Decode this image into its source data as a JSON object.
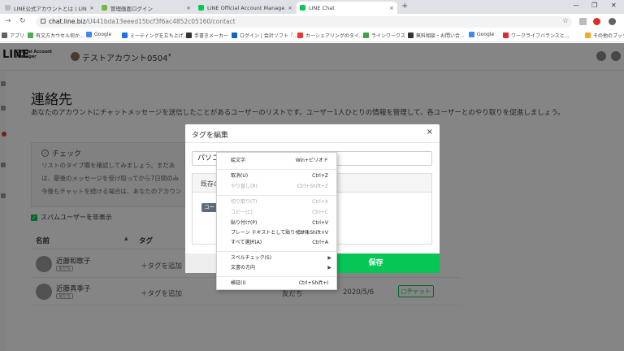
{
  "browser": {
    "tabs": [
      {
        "title": "LINE公式アカウントとは | LINE for Bu",
        "favicon": "grey"
      },
      {
        "title": "管理画面ログイン",
        "favicon": "img"
      },
      {
        "title": "LINE Official Account Manager",
        "favicon": "line"
      },
      {
        "title": "LINE Chat",
        "favicon": "line"
      }
    ],
    "new_tab": "+",
    "url_host": "chat.line.biz",
    "url_path": "/U441bda13eeed15bcf3f6ac4852c05160/contact",
    "bookmarks": [
      "アプリ",
      "有文方カウセル何か...",
      "Google",
      "ミーティングを立ち上げ...",
      "手書きメーカー",
      "ログイン | 会計ソフト「...",
      "カーシェアリングのタイ...",
      "ラインワークス",
      "無料相談・お問い合...",
      "Google",
      "ワークライフバランスと...",
      "その他のブックマーク"
    ]
  },
  "app": {
    "logo": "LINE",
    "logo_sub_1": "Official Account",
    "logo_sub_2": "Manager",
    "account_name": "テストアカウント0504",
    "caret": "▾"
  },
  "page": {
    "title": "連絡先",
    "description": "あなたのアカウントにチャットメッセージを送信したことがあるユーザーのリストです。ユーザー1人ひとりの情報を管理して、各ユーザーとのやり取りを促進しましょう。",
    "check_box": {
      "title": "チェック",
      "lines": [
        "リストのタイプ欄を確認してみましょう。まだあ",
        "は、最後のメッセージを受け取ってから7日間のみ",
        "今後もチャットを続ける場合は、あなたのアカウン"
      ]
    },
    "spam_label": "スパムユーザーを非表示",
    "columns": {
      "name": "名前",
      "tag": "タグ"
    },
    "rows": [
      {
        "name": "近藤和歌子",
        "pill": "友だち",
        "add_tag": "＋タグを追加",
        "status": "",
        "date": "",
        "chat": ""
      },
      {
        "name": "近藤真季子",
        "pill": "友だち",
        "add_tag": "＋タグを追加",
        "status": "友だち",
        "date": "2020/5/6",
        "chat": "チャット"
      }
    ]
  },
  "modal": {
    "title": "タグを編集",
    "close": "×",
    "input_value": "パソコ",
    "existing_label": "既存の",
    "existing_tag": "コー",
    "save": "保存"
  },
  "context_menu": [
    {
      "label": "絵文字",
      "shortcut": "Win+ピリオド",
      "disabled": false
    },
    {
      "sep": true
    },
    {
      "label": "取消(U)",
      "shortcut": "Ctrl+Z",
      "disabled": false
    },
    {
      "label": "やり直し(R)",
      "shortcut": "Ctrl+Shift+Z",
      "disabled": true
    },
    {
      "sep": true
    },
    {
      "label": "切り取り(T)",
      "shortcut": "Ctrl+X",
      "disabled": true
    },
    {
      "label": "コピー(C)",
      "shortcut": "Ctrl+C",
      "disabled": true
    },
    {
      "label": "貼り付け(P)",
      "shortcut": "Ctrl+V",
      "disabled": false
    },
    {
      "label": "プレーン テキストとして貼り付ける",
      "shortcut": "Ctrl+Shift+V",
      "disabled": false
    },
    {
      "label": "すべて選択(A)",
      "shortcut": "Ctrl+A",
      "disabled": false
    },
    {
      "sep": true
    },
    {
      "label": "スペルチェック(S)",
      "shortcut": "",
      "submenu": true,
      "disabled": false
    },
    {
      "label": "文書の方向",
      "shortcut": "",
      "submenu": true,
      "disabled": false
    },
    {
      "sep": true
    },
    {
      "label": "検証(I)",
      "shortcut": "Ctrl+Shift+I",
      "disabled": false
    }
  ],
  "colors": {
    "line_green": "#06c755",
    "overlay": "#000000"
  }
}
